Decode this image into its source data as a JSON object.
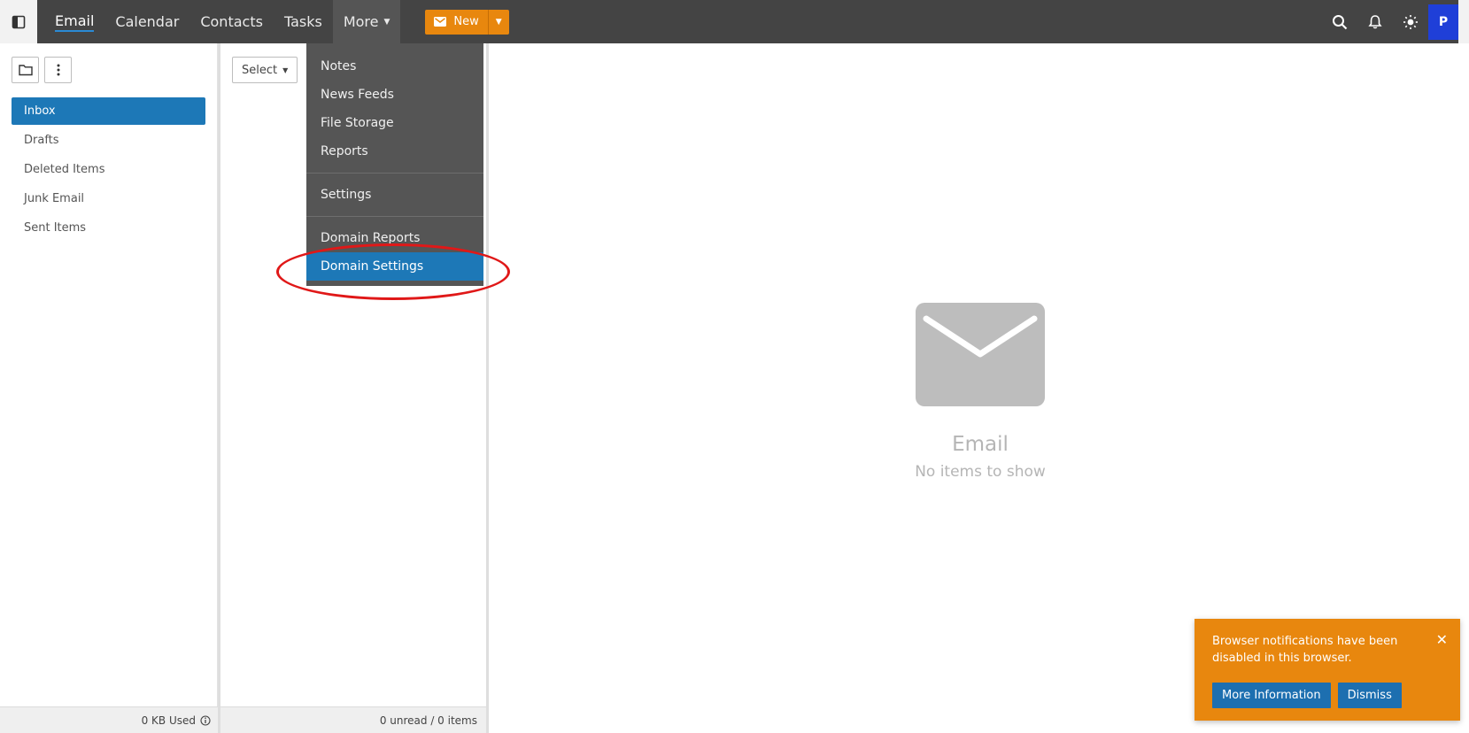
{
  "topbar": {
    "nav": [
      {
        "label": "Email",
        "active": true
      },
      {
        "label": "Calendar"
      },
      {
        "label": "Contacts"
      },
      {
        "label": "Tasks"
      },
      {
        "label": "More"
      }
    ],
    "new_label": "New",
    "avatar_initial": "P"
  },
  "more_menu": {
    "items": [
      "Notes",
      "News Feeds",
      "File Storage",
      "Reports",
      "Settings",
      "Domain Reports",
      "Domain Settings"
    ],
    "highlighted": "Domain Settings"
  },
  "sidebar": {
    "folders": [
      "Inbox",
      "Drafts",
      "Deleted Items",
      "Junk Email",
      "Sent Items"
    ],
    "active_folder": "Inbox",
    "storage_used": "0 KB Used"
  },
  "message_list": {
    "select_label": "Select",
    "footer_status": "0 unread / 0 items"
  },
  "reading_pane": {
    "empty_title": "Email",
    "empty_subtitle": "No items to show"
  },
  "notification": {
    "message": "Browser notifications have been disabled in this browser.",
    "more_info_label": "More Information",
    "dismiss_label": "Dismiss"
  },
  "colors": {
    "topbar": "#444444",
    "accent_blue": "#1d78b7",
    "new_button": "#e8870e",
    "annotation": "#e01818"
  }
}
